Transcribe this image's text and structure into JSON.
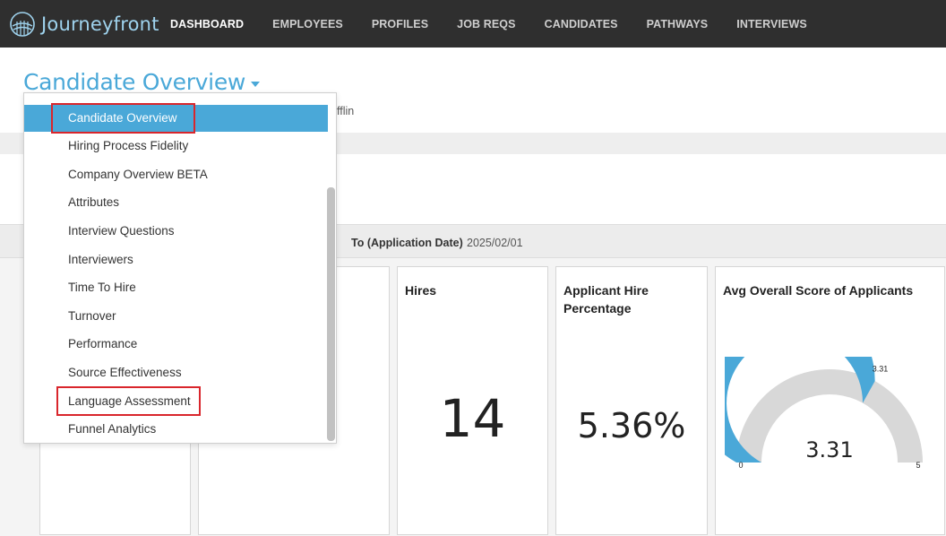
{
  "app": {
    "logo_text": "Journeyfront"
  },
  "nav": {
    "items": [
      {
        "label": "DASHBOARD",
        "active": true
      },
      {
        "label": "EMPLOYEES"
      },
      {
        "label": "PROFILES"
      },
      {
        "label": "JOB REQS"
      },
      {
        "label": "CANDIDATES"
      },
      {
        "label": "PATHWAYS"
      },
      {
        "label": "INTERVIEWS"
      }
    ]
  },
  "header": {
    "title": "Candidate Overview",
    "breadcrumb_tail": "fflin"
  },
  "dropdown": {
    "items": [
      {
        "label": "Candidate Overview",
        "selected": true
      },
      {
        "label": "Hiring Process Fidelity"
      },
      {
        "label": "Company Overview BETA"
      },
      {
        "label": "Attributes"
      },
      {
        "label": "Interview Questions"
      },
      {
        "label": "Interviewers"
      },
      {
        "label": "Time To Hire"
      },
      {
        "label": "Turnover"
      },
      {
        "label": "Performance"
      },
      {
        "label": "Source Effectiveness"
      },
      {
        "label": "Language Assessment"
      },
      {
        "label": "Funnel Analytics"
      }
    ]
  },
  "filters": {
    "to_label": "To (Application Date)",
    "to_value": "2025/02/01"
  },
  "cards": {
    "hires": {
      "title": "Hires",
      "value": "14"
    },
    "hire_pct": {
      "title_line1": "Applicant Hire",
      "title_line2": "Percentage",
      "value": "5.36%"
    },
    "avg_score": {
      "title": "Avg Overall Score of Applicants",
      "value": "3.31",
      "marker_label": "3.31",
      "min_label": "0",
      "max_label": "5",
      "min": 0,
      "max": 5,
      "score": 3.31,
      "fill_color": "#4aa8d8",
      "track_color": "#d8d8d8"
    }
  }
}
